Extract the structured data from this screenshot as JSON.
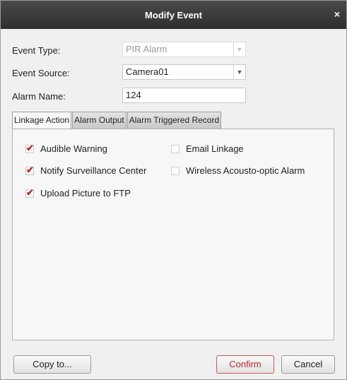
{
  "dialog": {
    "title": "Modify Event",
    "close_glyph": "×"
  },
  "form": {
    "event_type": {
      "label": "Event Type:",
      "value": "PIR Alarm"
    },
    "event_source": {
      "label": "Event Source:",
      "value": "Camera01"
    },
    "alarm_name": {
      "label": "Alarm Name:",
      "value": "124"
    }
  },
  "tabs": [
    {
      "label": "Linkage Action",
      "active": true
    },
    {
      "label": "Alarm Output",
      "active": false
    },
    {
      "label": "Alarm Triggered Record",
      "active": false
    }
  ],
  "linkage": {
    "checkmark": "✔",
    "options": [
      {
        "label": "Audible Warning",
        "checked": true
      },
      {
        "label": "Email Linkage",
        "checked": false
      },
      {
        "label": "Notify Surveillance Center",
        "checked": true
      },
      {
        "label": "Wireless Acousto-optic Alarm",
        "checked": false
      },
      {
        "label": "Upload Picture to FTP",
        "checked": true
      }
    ]
  },
  "buttons": {
    "copy_to": "Copy to...",
    "confirm": "Confirm",
    "cancel": "Cancel"
  },
  "icons": {
    "dropdown": "chevron-down-icon",
    "close": "close-icon",
    "check": "checkmark-icon"
  }
}
